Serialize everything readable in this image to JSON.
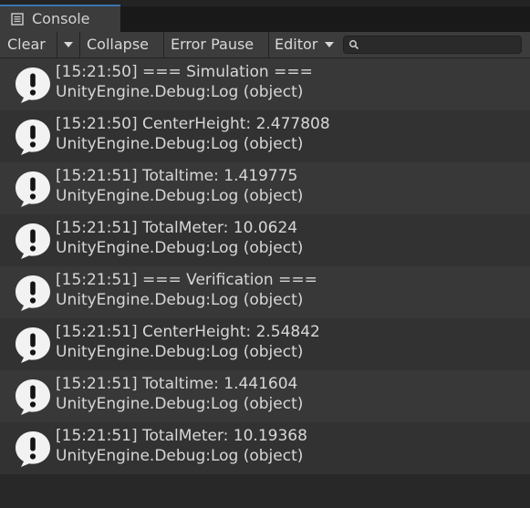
{
  "window": {
    "tab_title": "Console",
    "tab_icon": "console-icon"
  },
  "toolbar": {
    "clear_label": "Clear",
    "collapse_label": "Collapse",
    "error_pause_label": "Error Pause",
    "editor_label": "Editor",
    "search_value": "",
    "search_placeholder": ""
  },
  "colors": {
    "background": "#282828",
    "row_alt": "#383838",
    "row": "#323232",
    "toolbar": "#3c3c3c",
    "text": "#d7d7d7",
    "tab_accent": "#3a72b0"
  },
  "logs": [
    {
      "line1": "[15:21:50] === Simulation ===",
      "line2": "UnityEngine.Debug:Log (object)"
    },
    {
      "line1": "[15:21:50] CenterHeight: 2.477808",
      "line2": "UnityEngine.Debug:Log (object)"
    },
    {
      "line1": "[15:21:51] Totaltime: 1.419775",
      "line2": "UnityEngine.Debug:Log (object)"
    },
    {
      "line1": "[15:21:51] TotalMeter: 10.0624",
      "line2": "UnityEngine.Debug:Log (object)"
    },
    {
      "line1": "[15:21:51] === Verification ===",
      "line2": "UnityEngine.Debug:Log (object)"
    },
    {
      "line1": "[15:21:51] CenterHeight: 2.54842",
      "line2": "UnityEngine.Debug:Log (object)"
    },
    {
      "line1": "[15:21:51] Totaltime: 1.441604",
      "line2": "UnityEngine.Debug:Log (object)"
    },
    {
      "line1": "[15:21:51] TotalMeter: 10.19368",
      "line2": "UnityEngine.Debug:Log (object)"
    }
  ],
  "log_icon": "info-message-icon"
}
